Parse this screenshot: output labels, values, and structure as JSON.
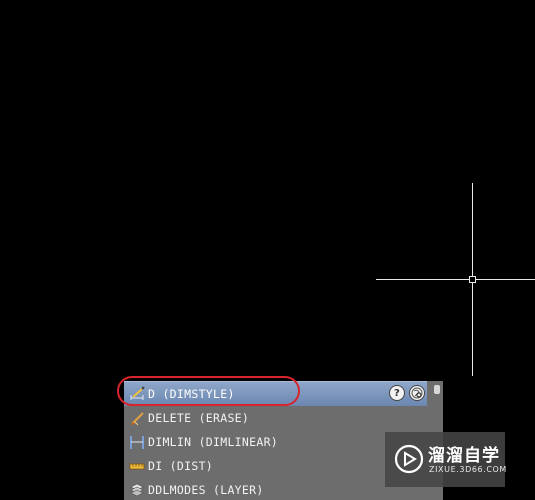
{
  "autocomplete": {
    "items": [
      {
        "label": "D (DIMSTYLE)",
        "icon": "dimstyle-icon",
        "selected": true
      },
      {
        "label": "DELETE (ERASE)",
        "icon": "erase-icon",
        "selected": false
      },
      {
        "label": "DIMLIN (DIMLINEAR)",
        "icon": "dimlinear-icon",
        "selected": false
      },
      {
        "label": "DI (DIST)",
        "icon": "dist-icon",
        "selected": false
      },
      {
        "label": "DDLMODES (LAYER)",
        "icon": "layer-icon",
        "selected": false
      }
    ],
    "help_button": "?",
    "colors": {
      "panel": "#6d6d6d",
      "selected": "#7a93bb",
      "highlight_ring": "#d8242b"
    }
  },
  "watermark": {
    "title": "溜溜自学",
    "url": "ZIXUE.3D66.COM"
  }
}
